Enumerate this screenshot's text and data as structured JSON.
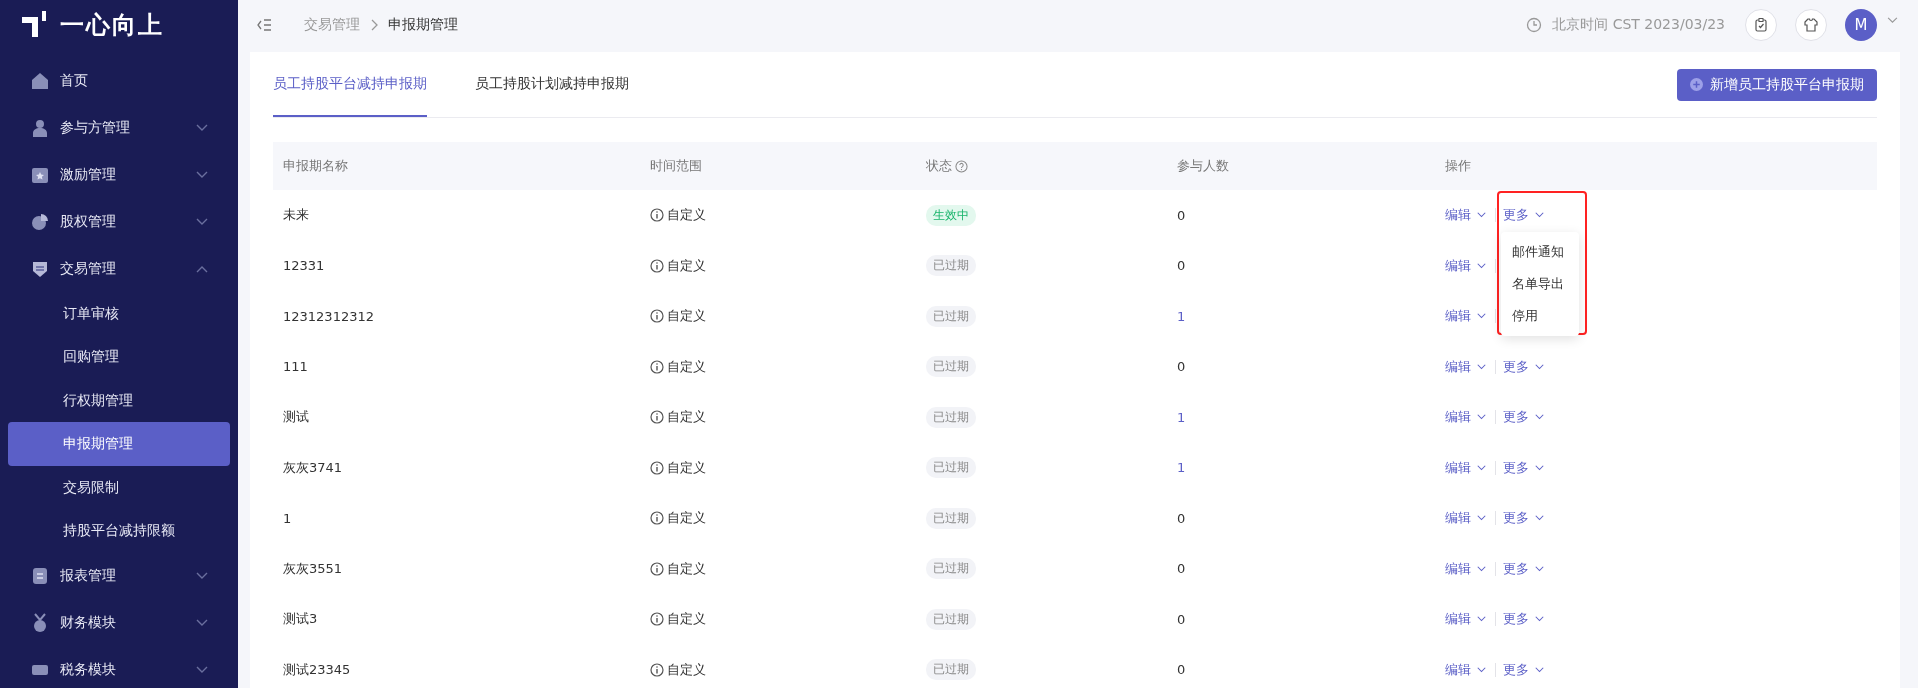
{
  "sidebar": {
    "logo": "一心向上",
    "items": [
      {
        "label": "首页",
        "expandable": false
      },
      {
        "label": "参与方管理",
        "expandable": true,
        "expanded": false
      },
      {
        "label": "激励管理",
        "expandable": true,
        "expanded": false
      },
      {
        "label": "股权管理",
        "expandable": true,
        "expanded": false
      },
      {
        "label": "交易管理",
        "expandable": true,
        "expanded": true,
        "children": [
          {
            "label": "订单审核",
            "selected": false
          },
          {
            "label": "回购管理",
            "selected": false
          },
          {
            "label": "行权期管理",
            "selected": false
          },
          {
            "label": "申报期管理",
            "selected": true
          },
          {
            "label": "交易限制",
            "selected": false
          },
          {
            "label": "持股平台减持限额",
            "selected": false
          }
        ]
      },
      {
        "label": "报表管理",
        "expandable": true,
        "expanded": false
      },
      {
        "label": "财务模块",
        "expandable": true,
        "expanded": false
      },
      {
        "label": "税务模块",
        "expandable": true,
        "expanded": false
      }
    ]
  },
  "header": {
    "breadcrumb": [
      "交易管理",
      "申报期管理"
    ],
    "time": "北京时间 CST 2023/03/23",
    "avatar": "M"
  },
  "tabs": [
    {
      "label": "员工持股平台减持申报期",
      "selected": true
    },
    {
      "label": "员工持股计划减持申报期",
      "selected": false
    }
  ],
  "add_button": "新增员工持股平台申报期",
  "table": {
    "columns": [
      "申报期名称",
      "时间范围",
      "状态",
      "参与人数",
      "操作"
    ],
    "rows": [
      {
        "name": "未来",
        "range": "自定义",
        "status": "生效中",
        "active": true,
        "count": "0",
        "count_link": false,
        "edit": "编辑",
        "more": "更多"
      },
      {
        "name": "12331",
        "range": "自定义",
        "status": "已过期",
        "active": false,
        "count": "0",
        "count_link": false,
        "edit": "编辑"
      },
      {
        "name": "12312312312",
        "range": "自定义",
        "status": "已过期",
        "active": false,
        "count": "1",
        "count_link": true,
        "edit": "编辑"
      },
      {
        "name": "111",
        "range": "自定义",
        "status": "已过期",
        "active": false,
        "count": "0",
        "count_link": false,
        "edit": "编辑",
        "more": "更多"
      },
      {
        "name": "测试",
        "range": "自定义",
        "status": "已过期",
        "active": false,
        "count": "1",
        "count_link": true,
        "edit": "编辑",
        "more": "更多"
      },
      {
        "name": "灰灰3741",
        "range": "自定义",
        "status": "已过期",
        "active": false,
        "count": "1",
        "count_link": true,
        "edit": "编辑",
        "more": "更多"
      },
      {
        "name": "1",
        "range": "自定义",
        "status": "已过期",
        "active": false,
        "count": "0",
        "count_link": false,
        "edit": "编辑",
        "more": "更多"
      },
      {
        "name": "灰灰3551",
        "range": "自定义",
        "status": "已过期",
        "active": false,
        "count": "0",
        "count_link": false,
        "edit": "编辑",
        "more": "更多"
      },
      {
        "name": "测试3",
        "range": "自定义",
        "status": "已过期",
        "active": false,
        "count": "0",
        "count_link": false,
        "edit": "编辑",
        "more": "更多"
      },
      {
        "name": "测试23345",
        "range": "自定义",
        "status": "已过期",
        "active": false,
        "count": "0",
        "count_link": false,
        "edit": "编辑",
        "more": "更多"
      }
    ]
  },
  "more_menu": {
    "highlighted": true,
    "items": [
      "邮件通知",
      "名单导出",
      "停用"
    ]
  }
}
